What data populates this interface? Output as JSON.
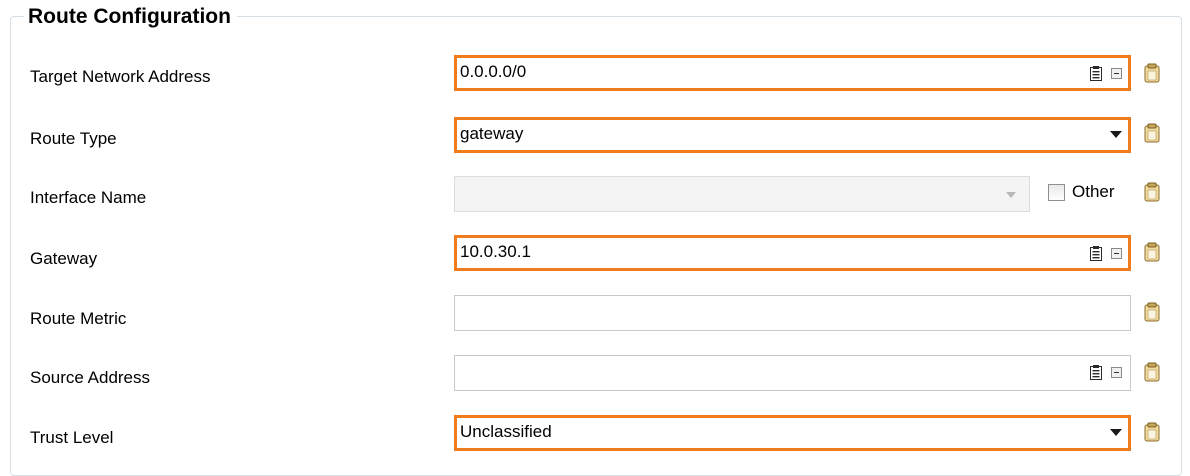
{
  "group": {
    "title": "Route Configuration"
  },
  "fields": {
    "target_network_address": {
      "label": "Target Network Address",
      "value": "0.0.0.0/0"
    },
    "route_type": {
      "label": "Route Type",
      "value": "gateway"
    },
    "interface_name": {
      "label": "Interface Name",
      "value": "",
      "other_label": "Other",
      "other_checked": false
    },
    "gateway": {
      "label": "Gateway",
      "value": "10.0.30.1"
    },
    "route_metric": {
      "label": "Route Metric",
      "value": ""
    },
    "source_address": {
      "label": "Source Address",
      "value": ""
    },
    "trust_level": {
      "label": "Trust Level",
      "value": "Unclassified"
    }
  },
  "icons": {
    "address_picker": "address-book-icon",
    "collapse": "minus-box-icon",
    "side": "clipboard-icon",
    "dropdown": "chevron-down-icon"
  },
  "colors": {
    "highlight": "#f07c1e",
    "field_border": "#c9c9c9",
    "disabled_bg": "#f4f4f4",
    "group_border": "#d5dfe5"
  }
}
